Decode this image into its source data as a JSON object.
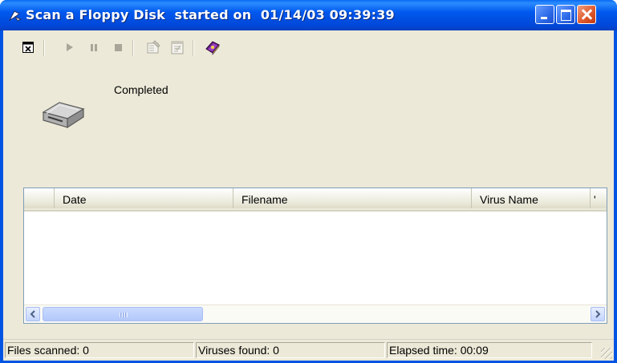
{
  "window": {
    "title": "Scan a Floppy Disk  started on  01/14/03 09:39:39",
    "controls": {
      "minimize": "minimize",
      "maximize": "maximize",
      "close": "close"
    }
  },
  "toolbar": {
    "buttons": [
      {
        "name": "close-scan",
        "icon": "close-window-icon",
        "enabled": true
      },
      {
        "name": "play",
        "icon": "play-icon",
        "enabled": false
      },
      {
        "name": "pause",
        "icon": "pause-icon",
        "enabled": false
      },
      {
        "name": "stop",
        "icon": "stop-icon",
        "enabled": false
      },
      {
        "name": "properties",
        "icon": "properties-icon",
        "enabled": false
      },
      {
        "name": "log",
        "icon": "log-icon",
        "enabled": false
      },
      {
        "name": "help",
        "icon": "help-book-icon",
        "enabled": true
      }
    ]
  },
  "scan": {
    "status": "Completed",
    "target_icon": "floppy-drive-icon"
  },
  "results": {
    "columns": [
      "",
      "Date",
      "Filename",
      "Virus Name",
      "'"
    ],
    "rows": []
  },
  "statusbar": {
    "files_scanned": "Files scanned: 0",
    "viruses_found": "Viruses found: 0",
    "elapsed_time": "Elapsed time: 00:09"
  },
  "colors": {
    "titlebar": "#0058ee",
    "face": "#ece9d8",
    "close_button": "#e05a2e"
  }
}
